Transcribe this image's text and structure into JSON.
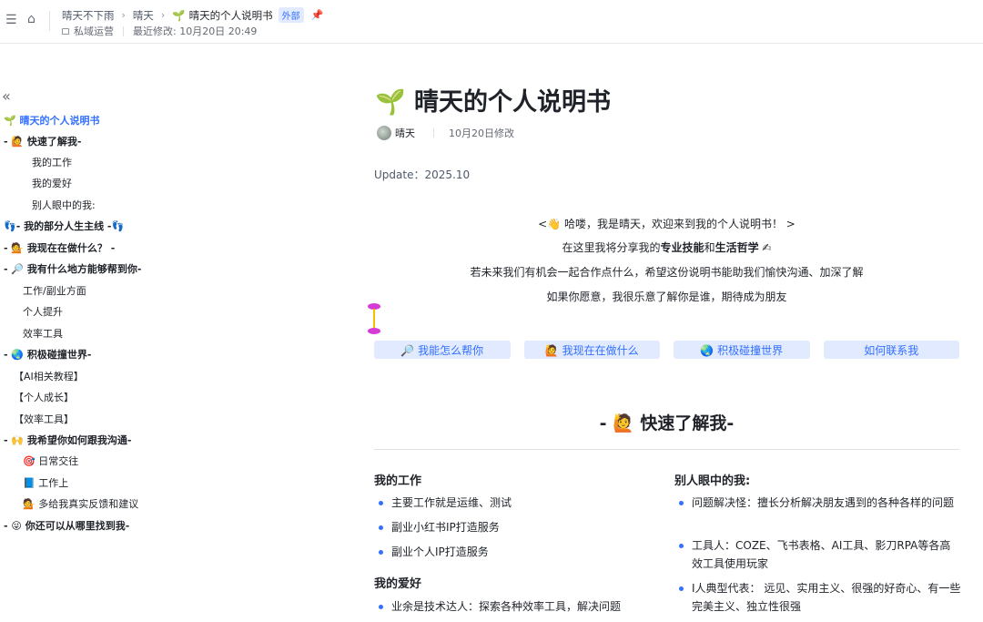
{
  "topbar": {
    "crumbs": [
      "晴天不下雨",
      "晴天",
      "晴天的个人说明书"
    ],
    "sprout_icon": "🌱",
    "badge": "外部",
    "folder": "私域运营",
    "last_modified": "最近修改: 10月20日 20:49"
  },
  "outline": {
    "collapse_glyph": "«",
    "items": [
      {
        "label": "🌱 晴天的个人说明书",
        "style": "active"
      },
      {
        "label": "- 🙋 快速了解我-",
        "style": "bold"
      },
      {
        "label": "我的工作",
        "style": "normal"
      },
      {
        "label": "我的爱好",
        "style": "normal"
      },
      {
        "label": "别人眼中的我:",
        "style": "normal"
      },
      {
        "label": "👣- 我的部分人生主线 -👣",
        "style": "bold"
      },
      {
        "label": "- 💁 我现在在做什么？ -",
        "style": "bold"
      },
      {
        "label": "- 🔎 我有什么地方能够帮到你-",
        "style": "bold"
      },
      {
        "label": "工作/副业方面",
        "style": "normal"
      },
      {
        "label": "个人提升",
        "style": "normal"
      },
      {
        "label": "效率工具",
        "style": "normal"
      },
      {
        "label": "- 🌏 积极碰撞世界-",
        "style": "bold"
      },
      {
        "label": "【AI相关教程】",
        "style": "normal"
      },
      {
        "label": "【个人成长】",
        "style": "normal"
      },
      {
        "label": "【效率工具】",
        "style": "normal"
      },
      {
        "label": "- 🙌 我希望你如何跟我沟通-",
        "style": "bold"
      },
      {
        "label": "🎯 日常交往",
        "style": "normal"
      },
      {
        "label": "📘 工作上",
        "style": "normal"
      },
      {
        "label": "💁 多给我真实反馈和建议",
        "style": "normal"
      },
      {
        "label": "- 😜 你还可以从哪里找到我-",
        "style": "bold"
      }
    ]
  },
  "doc": {
    "title": "🌱 晴天的个人说明书",
    "author": "晴天",
    "modified": "10月20日修改",
    "update": "Update：2025.10",
    "intro_line1": "<👋 哈喽，我是晴天，欢迎来到我的个人说明书！ >",
    "intro_line2_pre": "在这里我将分享我的",
    "intro_line2_b1": "专业技能",
    "intro_line2_mid": "和",
    "intro_line2_b2": "生活哲学",
    "intro_line2_post": " ✍",
    "intro_line3": "若未来我们有机会一起合作点什么，希望这份说明书能助我们愉快沟通、加深了解",
    "intro_line4": "如果你愿意，我很乐意了解你是谁，期待成为朋友",
    "buttons": [
      "🔎 我能怎么帮你",
      "🙋 我现在在做什么",
      "🌏 积极碰撞世界",
      "如何联系我"
    ],
    "section_title": "- 🙋 快速了解我-",
    "work": {
      "heading": "我的工作",
      "items": [
        "主要工作就是运维、测试",
        "副业小红书IP打造服务",
        "副业个人IP打造服务"
      ]
    },
    "hobby": {
      "heading": "我的爱好",
      "items": [
        "业余是技术达人：探索各种效率工具，解决问题"
      ]
    },
    "others": {
      "heading": "别人眼中的我:",
      "items": [
        "问题解决怪：擅长分析解决朋友遇到的各种各样的问题",
        "工具人：COZE、飞书表格、AI工具、影刀RPA等各高效工具使用玩家",
        "I人典型代表： 远见、实用主义、很强的好奇心、有一些完美主义、独立性很强"
      ]
    }
  }
}
